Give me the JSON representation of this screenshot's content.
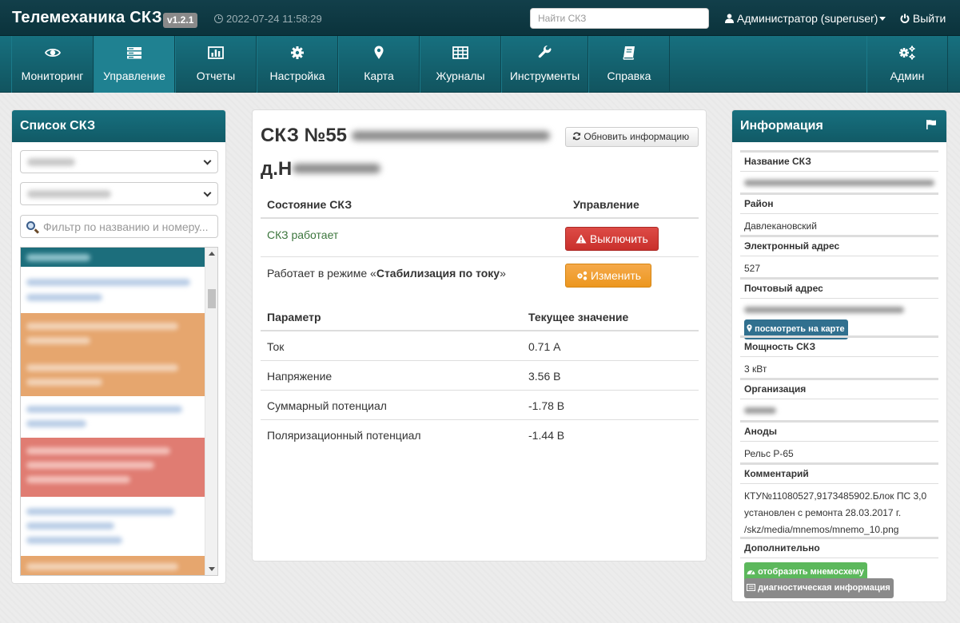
{
  "header": {
    "brand": "Телемеханика СКЗ",
    "version": "v1.2.1",
    "datetime": "2022-07-24 11:58:29",
    "search_placeholder": "Найти СКЗ",
    "user": "Администратор (superuser)",
    "logout": "Выйти"
  },
  "nav": {
    "items": [
      {
        "label": "Мониторинг",
        "icon": "eye-icon"
      },
      {
        "label": "Управление",
        "icon": "server-icon",
        "active": true
      },
      {
        "label": "Отчеты",
        "icon": "bar-chart-icon"
      },
      {
        "label": "Настройка",
        "icon": "gear-icon"
      },
      {
        "label": "Карта",
        "icon": "map-marker-icon"
      },
      {
        "label": "Журналы",
        "icon": "table-icon"
      },
      {
        "label": "Инструменты",
        "icon": "wrench-icon"
      },
      {
        "label": "Справка",
        "icon": "book-icon"
      },
      {
        "label": "Админ",
        "icon": "gears-icon"
      }
    ]
  },
  "left": {
    "title": "Список СКЗ",
    "filter_placeholder": "Фильтр по названию и номеру..."
  },
  "main": {
    "title_prefix": "СКЗ №55",
    "title_line2": "д.Н",
    "refresh_label": "Обновить информацию",
    "state_header": "Состояние СКЗ",
    "control_header": "Управление",
    "status_text": "СКЗ работает",
    "off_label": "Выключить",
    "mode_prefix": "Работает в режиме «",
    "mode_value": "Стабилизация по току",
    "mode_suffix": "»",
    "change_label": "Изменить",
    "param_header": "Параметр",
    "value_header": "Текущее значение",
    "params": [
      {
        "name": "Ток",
        "value": "0.71 А"
      },
      {
        "name": "Напряжение",
        "value": "3.56 В"
      },
      {
        "name": "Суммарный потенциал",
        "value": "-1.78 В"
      },
      {
        "name": "Поляризационный потенциал",
        "value": "-1.44 В"
      }
    ]
  },
  "info": {
    "title": "Информация",
    "name_label": "Название СКЗ",
    "district_label": "Район",
    "district_value": "Давлекановский",
    "email_label": "Электронный адрес",
    "email_value": "527",
    "postal_label": "Почтовый адрес",
    "map_link": "посмотреть на карте",
    "power_label": "Мощность СКЗ",
    "power_value": "3 кВт",
    "org_label": "Организация",
    "anodes_label": "Аноды",
    "anodes_value": "Рельс Р-65",
    "comment_label": "Комментарий",
    "comment_value": "КТУ№11080527,9173485902.Блок ПС 3,0 установлен с ремонта 28.03.2017 г. /skz/media/mnemos/mnemo_10.png",
    "extra_label": "Дополнительно",
    "mnemo_link": "отобразить мнемосхему",
    "diag_link": "диагностическая информация"
  },
  "colors": {
    "topbar": "#0e3a44",
    "navbar": "#14606e",
    "nav_active": "#1f8191",
    "success_text": "#3c763d",
    "danger": "#d9534f",
    "warning": "#f0ad4e",
    "info_label": "#31708f",
    "success_label": "#5cb85c",
    "muted_label": "#8a8a8a"
  }
}
